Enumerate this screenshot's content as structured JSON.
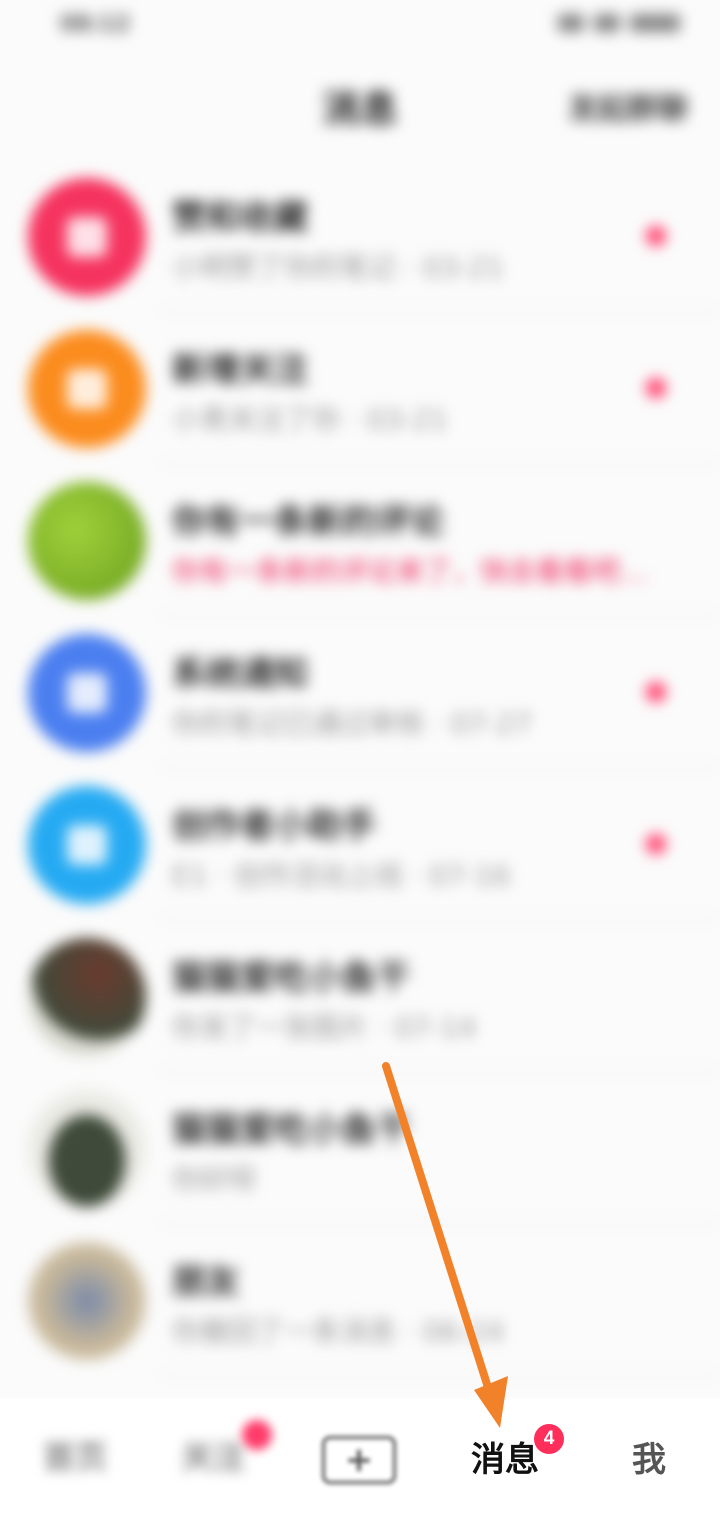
{
  "status_bar": {
    "time": "08:12"
  },
  "header": {
    "title": "消息",
    "right_action": "发起群聊"
  },
  "messages": [
    {
      "title": "赞和收藏",
      "subtitle": "小明赞了你的笔记 · 03-21",
      "avatar_color": "#f5335f",
      "unread": true
    },
    {
      "title": "新增关注",
      "subtitle": "小青关注了你 · 03-21",
      "avatar_color": "#fb8c1e",
      "unread": true
    },
    {
      "title": "你有一条新的评论",
      "subtitle": "你有一条新的评论来了，快去看看吧…",
      "avatar_color": "#7fb22a",
      "unread": false,
      "subtitle_alert": true
    },
    {
      "title": "系统通知",
      "subtitle": "你的笔记已通过审核 · 07-27",
      "avatar_color": "#4b7ff0",
      "unread": true
    },
    {
      "title": "创作者小助手",
      "subtitle": "E1 · 创作活动上线 · 07-16",
      "avatar_color": "#25aaf2",
      "unread": true
    },
    {
      "title": "猫猫爱吃小鱼干",
      "subtitle": "你发了一张图片 · 07-14",
      "avatar_color": "#4f5a45",
      "unread": false
    },
    {
      "title": "猫猫爱吃小鱼干",
      "subtitle": "你好呀",
      "avatar_color": "#3f4a3a",
      "unread": false
    },
    {
      "title": "朋友",
      "subtitle": "你撤回了一条消息 · 06-24",
      "avatar_color": "#b8a98e",
      "unread": false
    }
  ],
  "tabbar": {
    "home": "首页",
    "follow": "关注",
    "plus": "+",
    "messages": "消息",
    "messages_badge": "4",
    "me": "我"
  },
  "annotation": {
    "arrow_color": "#f2822a"
  }
}
